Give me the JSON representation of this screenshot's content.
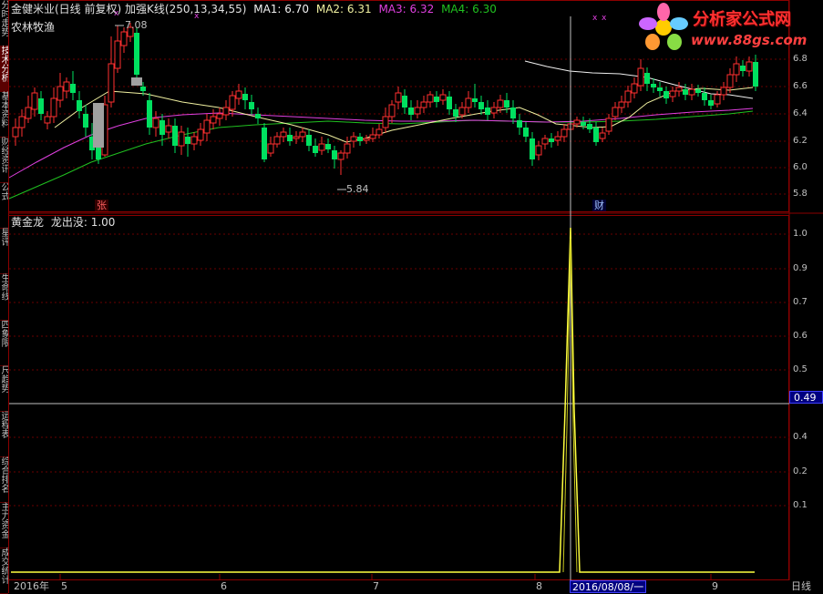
{
  "header": {
    "title": "金健米业(日线 前复权)",
    "indicator": "加强K线(250,13,34,55)",
    "ma1": "MA1: 6.70",
    "ma2": "MA2: 6.31",
    "ma3": "MA3: 6.32",
    "ma4": "MA4: 6.30",
    "sector": "农林牧渔"
  },
  "price_panel": {
    "high_marker": "7.08",
    "low_marker": "5.84",
    "tag_zhang": "张",
    "tag_cai": "财",
    "axis_ticks": [
      "6.8",
      "6.6",
      "6.4",
      "6.2",
      "6.0",
      "5.8"
    ]
  },
  "indicator_panel": {
    "name": "黄金龙",
    "line_label": "龙出没: 1.00",
    "axis_ticks": [
      "1.0",
      "0.9",
      "0.7",
      "0.6",
      "0.5",
      "0.4",
      "0.2",
      "0.1"
    ],
    "crosshair_value": "0.49"
  },
  "date_axis": {
    "labels": [
      "2016年",
      "5",
      "6",
      "7",
      "8",
      "9"
    ],
    "crosshair_date": "2016/08/08/一",
    "period": "日线"
  },
  "left_tabs": [
    "分时走势",
    "技术分析",
    "基本资料",
    "财经资讯",
    "公式",
    "星评",
    "生命线",
    "四象限",
    "尺趋势",
    "运程表",
    "综合排名",
    "主力资金",
    "成交统计"
  ],
  "logo": {
    "title": "分析家公式网",
    "url": "www.88gs.com"
  },
  "colors": {
    "up": "#ff3030",
    "down": "#00e060",
    "ma1": "#f0f0f0",
    "ma2": "#f0f0a0",
    "ma3": "#e040e0",
    "ma4": "#20c020",
    "indicator_line": "#ffff40",
    "grid": "#8b0000"
  }
}
